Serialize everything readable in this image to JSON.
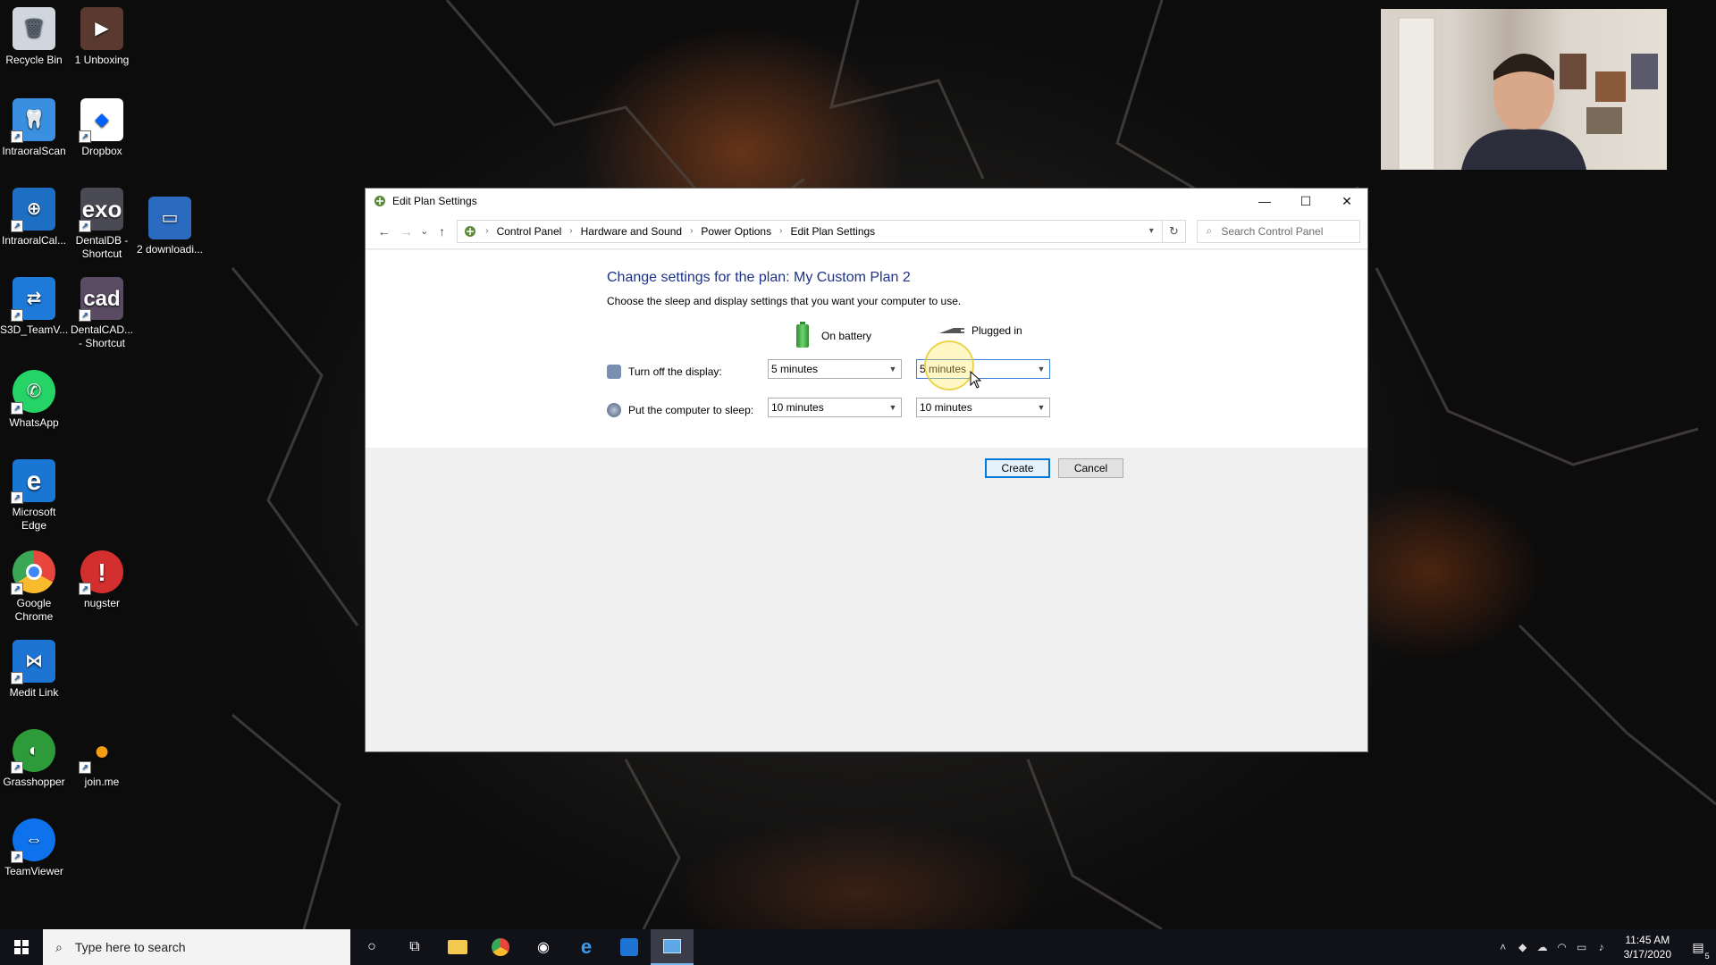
{
  "desktop": {
    "icons": [
      {
        "label": "Recycle Bin",
        "glyph": "🗑",
        "color": "#cfd6de"
      },
      {
        "label": "1 Unboxing",
        "glyph": "▶",
        "color": "#5a3a2e"
      },
      {
        "label": "IntraoralScan",
        "glyph": "🦷",
        "color": "#3a8fe0"
      },
      {
        "label": "Dropbox",
        "glyph": "◆",
        "color": "#ffffff"
      },
      {
        "label": "IntraoralCal...",
        "glyph": "⊕",
        "color": "#1d6fc4"
      },
      {
        "label": "exo",
        "glyph": "exo",
        "color": "#4a4a55"
      },
      {
        "label": "DentalDB - Shortcut",
        "glyph": "",
        "color": ""
      },
      {
        "label": "2 downloadi...",
        "glyph": "▭",
        "color": "#2a6bc0"
      },
      {
        "label": "S3D_TeamV...",
        "glyph": "⇄",
        "color": "#1e7ad8"
      },
      {
        "label": "cad",
        "glyph": "cad",
        "color": "#5a4a62"
      },
      {
        "label": "DentalCAD... - Shortcut",
        "glyph": "",
        "color": ""
      },
      {
        "label": "WhatsApp",
        "glyph": "✆",
        "color": "#25d366"
      },
      {
        "label": "Microsoft Edge",
        "glyph": "e",
        "color": "#1976d2"
      },
      {
        "label": "Google Chrome",
        "glyph": "◉",
        "color": "#e8453c"
      },
      {
        "label": "nugster",
        "glyph": "!",
        "color": "#d32f2f"
      },
      {
        "label": "Medit Link",
        "glyph": "⋈",
        "color": "#1e74d2"
      },
      {
        "label": "Grasshopper",
        "glyph": "◐",
        "color": "#2e9b3a"
      },
      {
        "label": "join.me",
        "glyph": "●",
        "color": "#f39c12"
      },
      {
        "label": "TeamViewer",
        "glyph": "⇔",
        "color": "#0e72ed"
      }
    ]
  },
  "window": {
    "title": "Edit Plan Settings",
    "controls": {
      "minimize": "—",
      "maximize": "☐",
      "close": "✕"
    },
    "nav": {
      "back": "←",
      "forward": "→",
      "recent": "⌄",
      "up": "↑"
    },
    "breadcrumb": [
      "Control Panel",
      "Hardware and Sound",
      "Power Options",
      "Edit Plan Settings"
    ],
    "search_placeholder": "Search Control Panel",
    "heading": "Change settings for the plan: My Custom Plan 2",
    "subheading": "Choose the sleep and display settings that you want your computer to use.",
    "columns": {
      "battery": "On battery",
      "plugged": "Plugged in"
    },
    "rows": [
      {
        "label": "Turn off the display:",
        "battery_value": "5 minutes",
        "plugged_value": "5 minutes"
      },
      {
        "label": "Put the computer to sleep:",
        "battery_value": "10 minutes",
        "plugged_value": "10 minutes"
      }
    ],
    "buttons": {
      "create": "Create",
      "cancel": "Cancel"
    }
  },
  "taskbar": {
    "search_placeholder": "Type here to search",
    "time": "11:45 AM",
    "date": "3/17/2020",
    "notification_count": "5"
  },
  "colors": {
    "heading": "#1e3287",
    "accent": "#0078d7",
    "taskbar": "#101218"
  }
}
